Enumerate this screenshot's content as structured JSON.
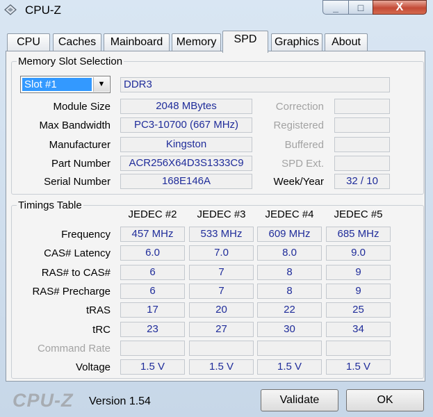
{
  "window": {
    "title": "CPU-Z",
    "minimize_glyph": "_",
    "maximize_glyph": "□",
    "close_glyph": "X"
  },
  "tabs": [
    {
      "label": "CPU",
      "active": false
    },
    {
      "label": "Caches",
      "active": false
    },
    {
      "label": "Mainboard",
      "active": false
    },
    {
      "label": "Memory",
      "active": false
    },
    {
      "label": "SPD",
      "active": true
    },
    {
      "label": "Graphics",
      "active": false
    },
    {
      "label": "About",
      "active": false
    }
  ],
  "slot_section": {
    "legend": "Memory Slot Selection",
    "slot_selected": "Slot #1",
    "memory_type": "DDR3",
    "labels": {
      "module_size": "Module Size",
      "max_bandwidth": "Max Bandwidth",
      "manufacturer": "Manufacturer",
      "part_number": "Part Number",
      "serial_number": "Serial Number",
      "correction": "Correction",
      "registered": "Registered",
      "buffered": "Buffered",
      "spd_ext": "SPD Ext.",
      "week_year": "Week/Year"
    },
    "values": {
      "module_size": "2048 MBytes",
      "max_bandwidth": "PC3-10700 (667 MHz)",
      "manufacturer": "Kingston",
      "part_number": "ACR256X64D3S1333C9",
      "serial_number": "168E146A",
      "correction": "",
      "registered": "",
      "buffered": "",
      "spd_ext": "",
      "week_year": "32 / 10"
    }
  },
  "timings": {
    "legend": "Timings Table",
    "columns": [
      "JEDEC #2",
      "JEDEC #3",
      "JEDEC #4",
      "JEDEC #5"
    ],
    "rows": [
      {
        "label": "Frequency",
        "values": [
          "457 MHz",
          "533 MHz",
          "609 MHz",
          "685 MHz"
        ]
      },
      {
        "label": "CAS# Latency",
        "values": [
          "6.0",
          "7.0",
          "8.0",
          "9.0"
        ]
      },
      {
        "label": "RAS# to CAS#",
        "values": [
          "6",
          "7",
          "8",
          "9"
        ]
      },
      {
        "label": "RAS# Precharge",
        "values": [
          "6",
          "7",
          "8",
          "9"
        ]
      },
      {
        "label": "tRAS",
        "values": [
          "17",
          "20",
          "22",
          "25"
        ]
      },
      {
        "label": "tRC",
        "values": [
          "23",
          "27",
          "30",
          "34"
        ]
      },
      {
        "label": "Command Rate",
        "values": [
          "",
          "",
          "",
          ""
        ],
        "dim": true
      },
      {
        "label": "Voltage",
        "values": [
          "1.5 V",
          "1.5 V",
          "1.5 V",
          "1.5 V"
        ]
      }
    ]
  },
  "footer": {
    "logo": "CPU-Z",
    "version": "Version 1.54",
    "validate_label": "Validate",
    "ok_label": "OK"
  }
}
